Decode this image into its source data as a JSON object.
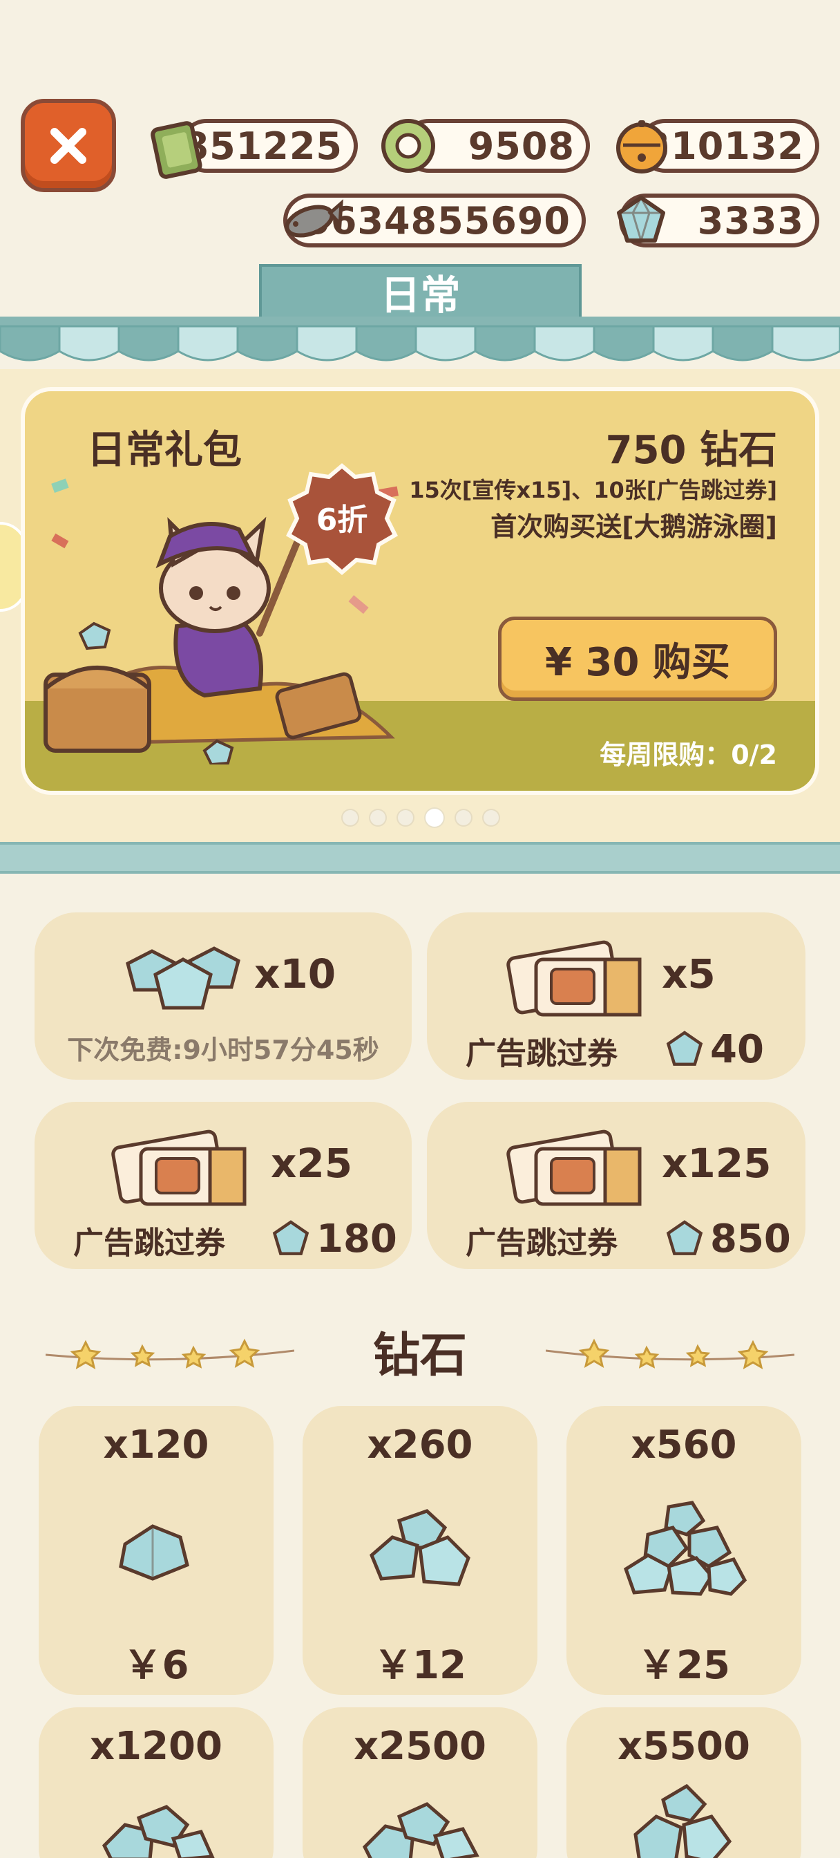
{
  "currencies": {
    "cash": "851225",
    "ring": "9508",
    "bell": "310132",
    "fish": "5634855690",
    "diamond": "3333"
  },
  "tab": {
    "label": "日常"
  },
  "banner": {
    "title": "日常礼包",
    "price": "750 钻石",
    "desc1": "15次[宣传x15]、10张[广告跳过券]",
    "desc2": "首次购买送[大鹅游泳圈]",
    "discount": "6折",
    "buy_label": "¥ 30 购买",
    "limit": "每周限购：0/2",
    "page_index": 4,
    "page_count": 6
  },
  "offers": [
    {
      "qty": "x10",
      "sub": "下次免费:9小时57分45秒"
    },
    {
      "qty": "x5",
      "label": "广告跳过券",
      "cost": "40"
    },
    {
      "qty": "x25",
      "label": "广告跳过券",
      "cost": "180"
    },
    {
      "qty": "x125",
      "label": "广告跳过券",
      "cost": "850"
    }
  ],
  "diamond_section": {
    "title": "钻石",
    "packs": [
      {
        "qty": "x120",
        "price": "￥6"
      },
      {
        "qty": "x260",
        "price": "￥12"
      },
      {
        "qty": "x560",
        "price": "￥25"
      },
      {
        "qty": "x1200"
      },
      {
        "qty": "x2500"
      },
      {
        "qty": "x5500"
      }
    ]
  },
  "colors": {
    "background": "#f6f1e3",
    "close_button": "#e0602a",
    "tab": "#7fb3b0",
    "banner": "#efd585",
    "buy_button": "#f7c560",
    "card": "#f2e4c2",
    "diamond": "#a8d8dc"
  },
  "icons": [
    "close-icon",
    "cash-icon",
    "ring-icon",
    "bell-icon",
    "fish-icon",
    "diamond-icon",
    "ticket-icon",
    "star-icon"
  ]
}
